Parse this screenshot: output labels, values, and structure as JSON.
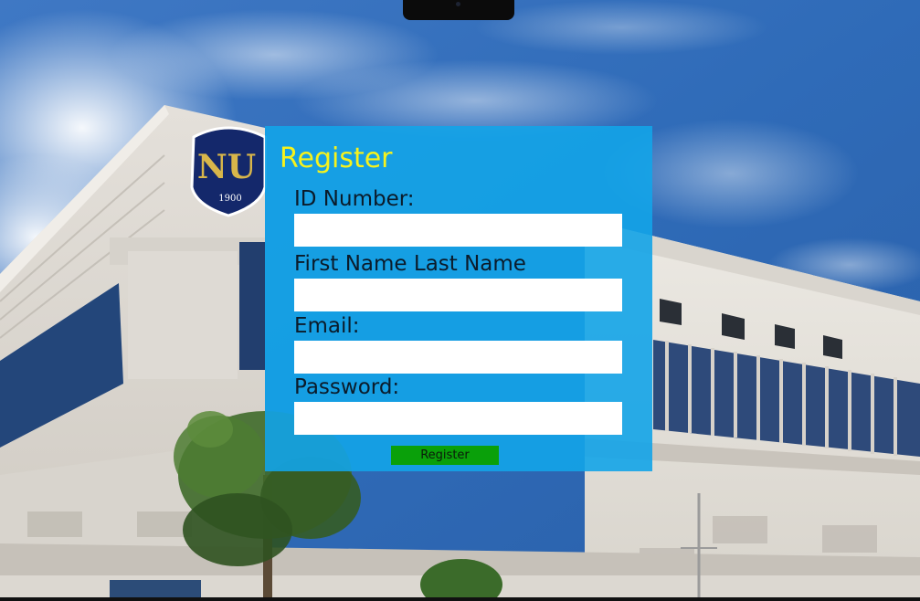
{
  "form": {
    "title": "Register",
    "fields": [
      {
        "label": "ID Number:",
        "value": "",
        "placeholder": ""
      },
      {
        "label": "First Name Last Name",
        "value": "",
        "placeholder": ""
      },
      {
        "label": "Email:",
        "value": "",
        "placeholder": ""
      },
      {
        "label": "Password:",
        "value": "",
        "placeholder": ""
      }
    ],
    "submit_label": "Register"
  },
  "background": {
    "logo_year": "1900",
    "logo_initials": "NU"
  },
  "colors": {
    "panel": "#13a4e8",
    "title": "#f7f21c",
    "button": "#0aa00a",
    "input": "#ffffff"
  }
}
